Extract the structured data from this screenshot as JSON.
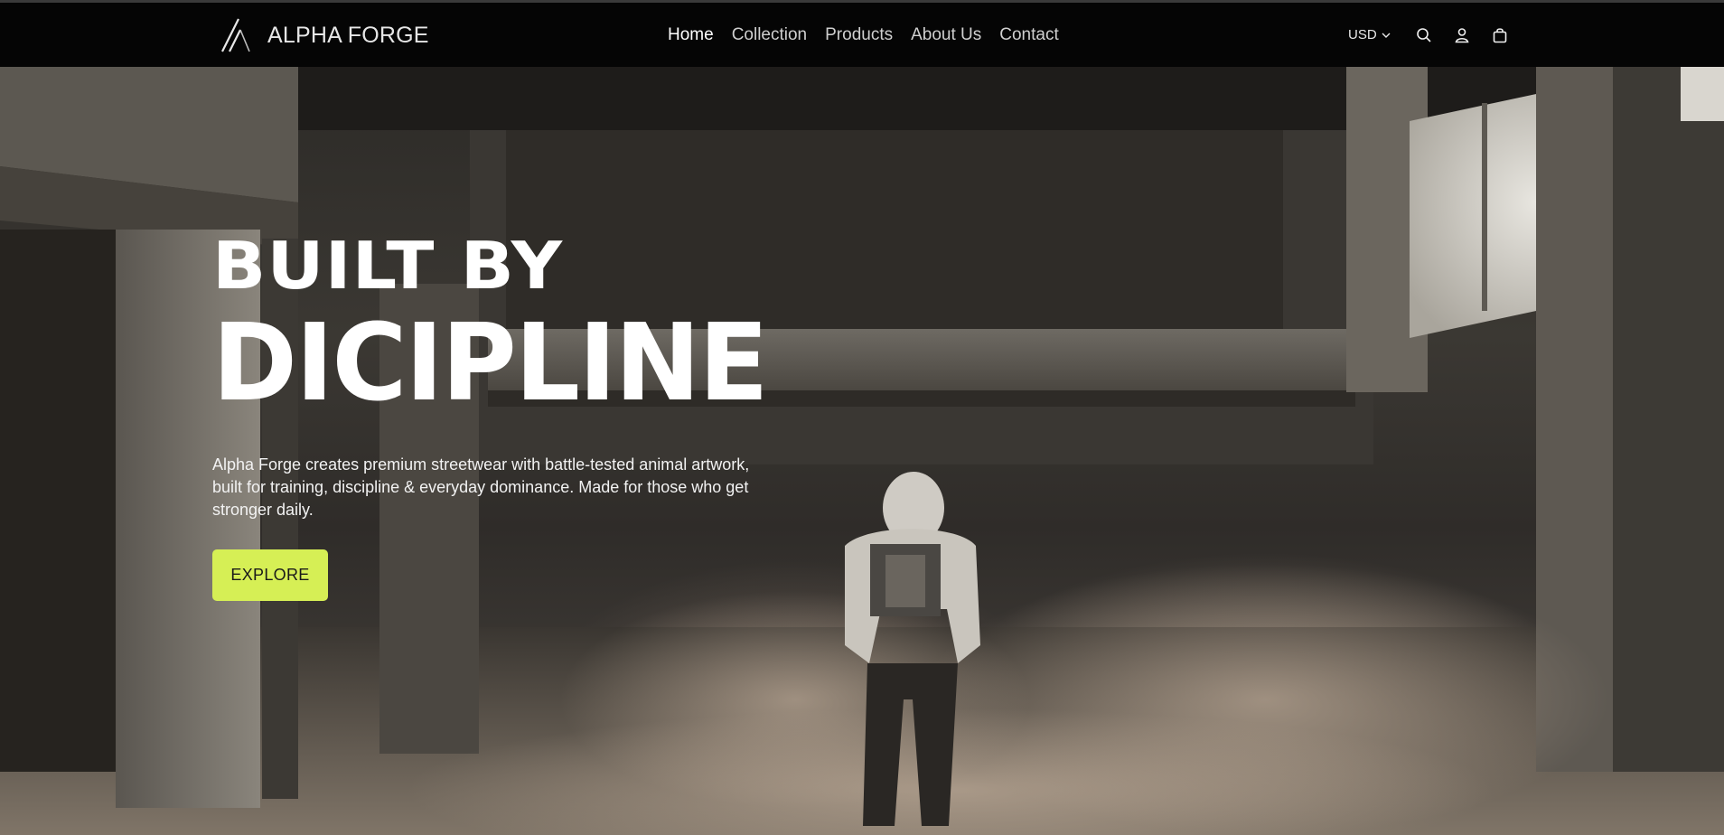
{
  "brand": {
    "name": "ALPHA FORGE",
    "logo_icon": "alpha-forge-logo"
  },
  "nav": {
    "items": [
      {
        "label": "Home",
        "active": true
      },
      {
        "label": "Collection",
        "active": false
      },
      {
        "label": "Products",
        "active": false
      },
      {
        "label": "About Us",
        "active": false
      },
      {
        "label": "Contact",
        "active": false
      }
    ]
  },
  "utilities": {
    "currency": "USD",
    "icons": [
      "chevron-down-icon",
      "search-icon",
      "account-icon",
      "cart-icon"
    ]
  },
  "hero": {
    "headline_line1": "BUILT BY",
    "headline_line2": "DICIPLINE",
    "description": "Alpha Forge creates premium streetwear with battle-tested animal artwork, built for training, discipline & everyday dominance. Made for those who get stronger daily.",
    "cta_label": "EXPLORE"
  },
  "colors": {
    "navbar_bg": "#050505",
    "accent": "#d6ef55",
    "text_primary": "#ffffff"
  }
}
